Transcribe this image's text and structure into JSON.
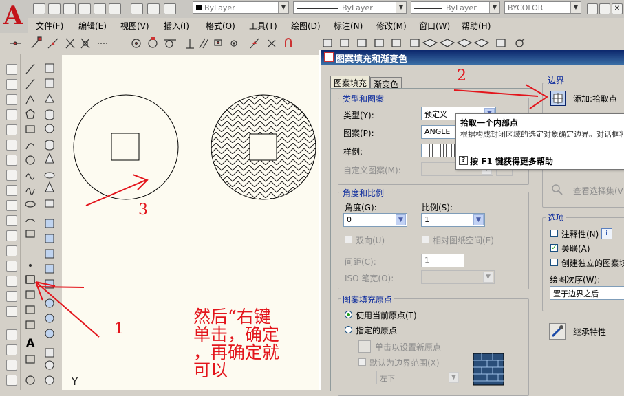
{
  "quick_access": {
    "layer_combo": "ByLayer",
    "linetype_combo": "ByLayer",
    "lineweight_combo": "ByLayer",
    "plotstyle_combo": "BYCOLOR"
  },
  "menu": [
    "文件(F)",
    "编辑(E)",
    "视图(V)",
    "插入(I)",
    "格式(O)",
    "工具(T)",
    "绘图(D)",
    "标注(N)",
    "修改(M)",
    "窗口(W)",
    "帮助(H)"
  ],
  "canvas": {
    "ucs_label": "Y"
  },
  "dialog": {
    "title": "图案填充和渐变色",
    "tabs": [
      "图案填充",
      "渐变色"
    ],
    "type_pattern": {
      "title": "类型和图案",
      "type_label": "类型(Y):",
      "type_value": "预定义",
      "pattern_label": "图案(P):",
      "pattern_value": "ANGLE",
      "swatch_label": "样例:",
      "custom_label": "自定义图案(M):"
    },
    "angle_scale": {
      "title": "角度和比例",
      "angle_label": "角度(G):",
      "angle_value": "0",
      "scale_label": "比例(S):",
      "scale_value": "1",
      "double_label": "双向(U)",
      "relative_label": "相对图纸空间(E)",
      "spacing_label": "间距(C):",
      "spacing_value": "1",
      "iso_label": "ISO 笔宽(O):"
    },
    "origin": {
      "title": "图案填充原点",
      "use_current": "使用当前原点(T)",
      "specified": "指定的原点",
      "click_set": "单击以设置新原点",
      "default_extent": "默认为边界范围(X)",
      "position_value": "左下"
    },
    "boundary": {
      "title": "边界",
      "add_pick": "添加:拾取点",
      "view_selection": "查看选择集(V)"
    },
    "options": {
      "title": "选项",
      "annotative": "注释性(N)",
      "associative": "关联(A)",
      "create_separate": "创建独立的图案填",
      "draw_order_label": "绘图次序(W):",
      "draw_order_value": "置于边界之后"
    },
    "inherit": "继承特性",
    "tooltip": {
      "title": "拾取一个内部点",
      "body": "根据构成封闭区域的选定对象确定边界。对话框将会提示选择对象。",
      "help": "按 F1 键获得更多帮助"
    }
  },
  "annotations": {
    "n1": "1",
    "n2": "2",
    "n3": "3",
    "note_lines": [
      "然后“右键",
      "单击，确定",
      "，再确定就",
      "可以"
    ]
  },
  "colors": {
    "annotation_red": "#e3151c",
    "title_blue": "#0a246a",
    "canvas_bg": "#fdfbf1"
  }
}
